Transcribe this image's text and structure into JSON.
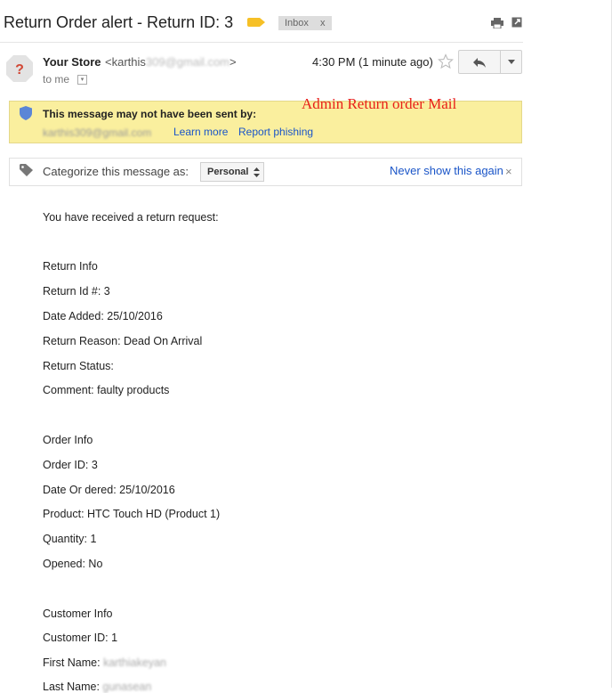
{
  "header": {
    "subject": "Return Order alert - Return ID: 3",
    "inbox_chip": "Inbox",
    "inbox_chip_close": "x"
  },
  "sender": {
    "name": "Your Store",
    "email_prefix": "<karthis",
    "email_redacted": "309@gmail.com",
    "email_suffix": ">",
    "to": "to me",
    "timestamp": "4:30 PM (1 minute ago)"
  },
  "annotation": "Admin Return order Mail",
  "warning": {
    "title": "This message may not have been sent by:",
    "sender_redacted": "karthis309@gmail.com",
    "learn_more": "Learn more",
    "report_phishing": "Report phishing"
  },
  "categorize": {
    "label": "Categorize this message as:",
    "selected": "Personal",
    "never_show": "Never show this again",
    "close": "×"
  },
  "body": {
    "intro": "You have received a return request:",
    "return_info": "Return Info",
    "return_id": "Return Id  #: 3",
    "date_added": "Date Added: 25/10/2016",
    "return_reason": "Return Reason: Dead On Arrival",
    "return_status": "Return Status:",
    "comment": "Comment: faulty products",
    "order_info": "Order Info",
    "order_id": "Order ID: 3",
    "date_ordered": "Date Or dered: 25/10/2016",
    "product": "Product: HTC Touch HD (Product 1)",
    "quantity": "Quantity: 1",
    "opened": "Opened: No",
    "customer_info": "Customer Info",
    "customer_id": "Customer ID: 1",
    "first_name_label": "First Name: ",
    "first_name_redacted": "karthiakeyan",
    "last_name_label": "Last Name: ",
    "last_name_redacted": "gunasean"
  },
  "colors": {
    "link": "#1a55c8",
    "warning_bg": "#faef9e",
    "annotation": "#e8201a",
    "label_tag": "#f6c026"
  }
}
